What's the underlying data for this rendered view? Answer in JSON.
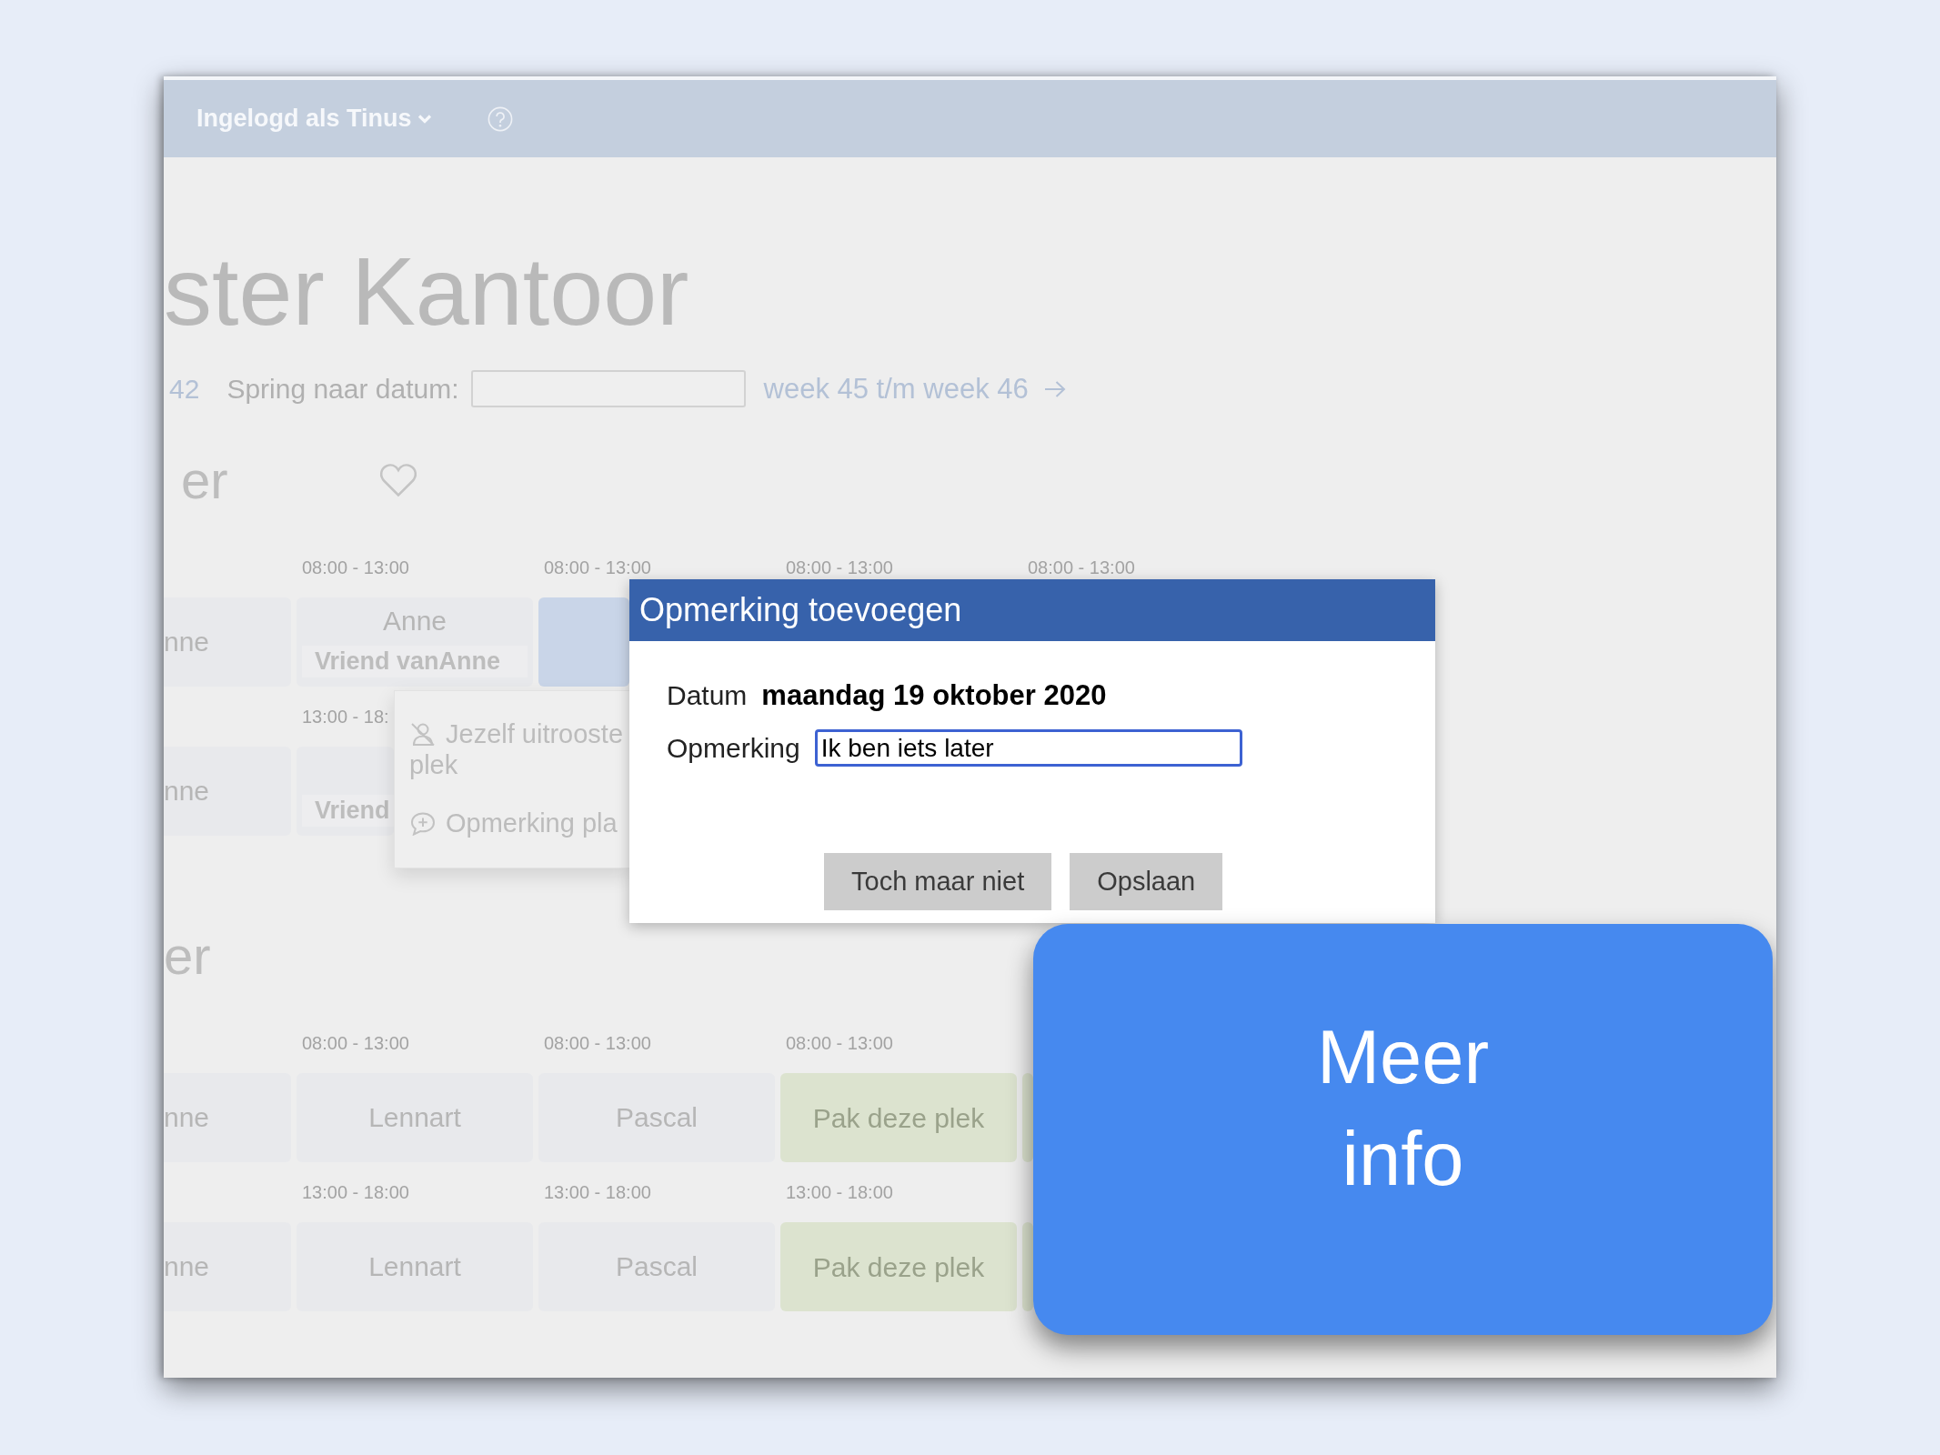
{
  "header": {
    "user_menu": "Ingelogd als Tinus"
  },
  "page": {
    "title": "ster Kantoor",
    "prev_weeks": "42",
    "jump_label": "Spring naar datum:",
    "next_weeks": "week 45 t/m week 46"
  },
  "sections": [
    {
      "heading": "er",
      "favorite": false,
      "rows": [
        {
          "slots": [
            {
              "kind": "taken",
              "name": "nne"
            },
            {
              "time": "08:00 - 13:00",
              "kind": "taken",
              "name": "Anne",
              "friend": "Vriend vanAnne"
            },
            {
              "time": "08:00 - 13:00",
              "kind": "mine"
            },
            {
              "time": "08:00 - 13:00"
            },
            {
              "time": "08:00 - 13:00"
            }
          ]
        },
        {
          "slots": [
            {
              "kind": "taken",
              "name": "nne"
            },
            {
              "time": "13:00 - 18:",
              "kind": "taken",
              "friend": "Vriend"
            }
          ]
        }
      ]
    },
    {
      "heading": "er",
      "rows": [
        {
          "slots": [
            {
              "kind": "taken",
              "name": "nne"
            },
            {
              "time": "08:00 - 13:00",
              "kind": "taken",
              "name": "Lennart"
            },
            {
              "time": "08:00 - 13:00",
              "kind": "taken",
              "name": "Pascal"
            },
            {
              "time": "08:00 - 13:00",
              "kind": "open",
              "label": "Pak deze plek"
            },
            {
              "kind": "open"
            }
          ]
        },
        {
          "slots": [
            {
              "kind": "taken",
              "name": "nne"
            },
            {
              "time": "13:00 - 18:00",
              "kind": "taken",
              "name": "Lennart"
            },
            {
              "time": "13:00 - 18:00",
              "kind": "taken",
              "name": "Pascal"
            },
            {
              "time": "13:00 - 18:00",
              "kind": "open",
              "label": "Pak deze plek"
            },
            {
              "kind": "open"
            }
          ]
        }
      ]
    }
  ],
  "context_menu": {
    "items": [
      {
        "label": "Jezelf uitrooste plek"
      },
      {
        "label": "Opmerking pla"
      }
    ]
  },
  "dialog": {
    "title": "Opmerking toevoegen",
    "date_label": "Datum",
    "date": "maandag 19 oktober 2020",
    "comment_label": "Opmerking",
    "comment_value": "Ik ben iets later",
    "buttons": [
      "Toch maar niet",
      "Opslaan"
    ]
  },
  "callout": {
    "text": "Meer info"
  }
}
